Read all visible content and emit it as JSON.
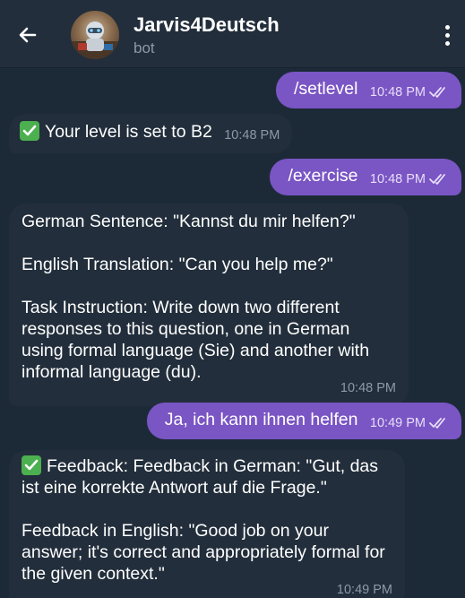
{
  "header": {
    "title": "Jarvis4Deutsch",
    "subtitle": "bot"
  },
  "messages": {
    "m1": {
      "text": "/setlevel",
      "time": "10:48 PM"
    },
    "m2": {
      "text": "Your level is set to B2",
      "time": "10:48 PM"
    },
    "m3": {
      "text": "/exercise",
      "time": "10:48 PM"
    },
    "m4": {
      "line1": "German Sentence: \"Kannst du mir helfen?\"",
      "line2": "English Translation: \"Can you help me?\"",
      "line3": "Task Instruction: Write down two different responses to this question, one in German using formal language (Sie) and another with informal language (du).",
      "time": "10:48 PM"
    },
    "m5": {
      "text": "Ja, ich kann ihnen helfen",
      "time": "10:49 PM"
    },
    "m6": {
      "line1": "Feedback: Feedback in German: \"Gut, das ist eine korrekte Antwort auf die Frage.\"",
      "line2": "Feedback in English: \"Good job on your answer; it's correct and appropriately formal for the given context.\"",
      "time": "10:49 PM"
    }
  },
  "colors": {
    "outgoing_bubble": "#7a55c4",
    "incoming_bubble": "#222e3b",
    "background": "#1c2a38",
    "check_emoji": "#4caf50"
  },
  "icons": [
    "back-arrow-icon",
    "more-vertical-icon",
    "double-check-icon",
    "check-mark-emoji-icon"
  ]
}
